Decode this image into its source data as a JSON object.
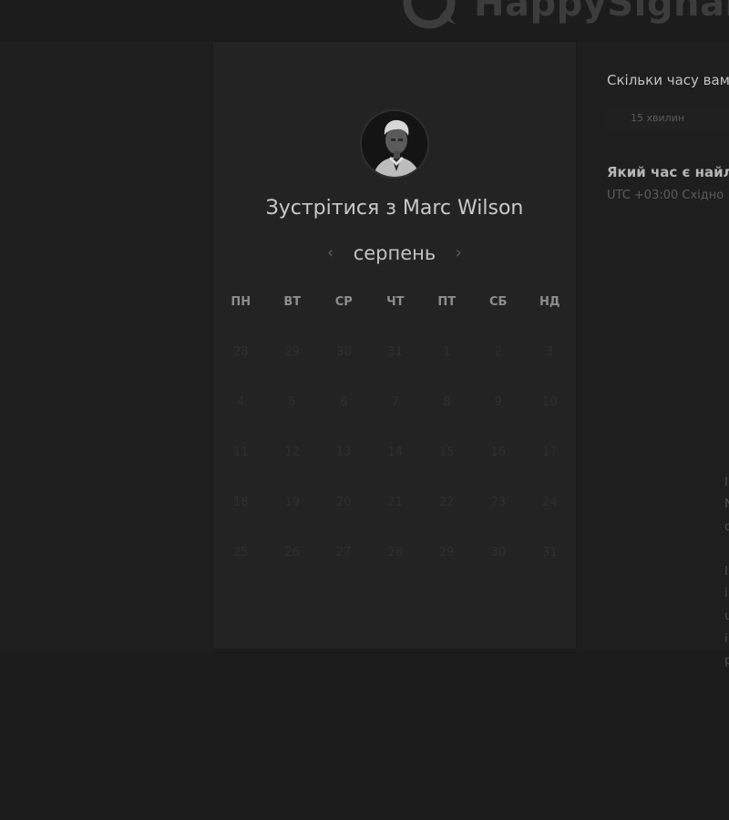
{
  "brand": {
    "logo_text": "HappySignals",
    "logo_icon": "speech-bubble-heart-icon"
  },
  "booking": {
    "title": "Зустрітися з Marc Wilson",
    "month": "серпень",
    "prev_icon": "chevron-left-icon",
    "next_icon": "chevron-right-icon",
    "weekdays": [
      "ПН",
      "ВТ",
      "СР",
      "ЧТ",
      "ПТ",
      "СБ",
      "НД"
    ],
    "days": [
      [
        "28",
        "29",
        "30",
        "31",
        "1",
        "2",
        "3"
      ],
      [
        "4",
        "5",
        "6",
        "7",
        "8",
        "9",
        "10"
      ],
      [
        "11",
        "12",
        "13",
        "14",
        "15",
        "16",
        "17"
      ],
      [
        "18",
        "19",
        "20",
        "21",
        "22",
        "23",
        "24"
      ],
      [
        "25",
        "26",
        "27",
        "28",
        "29",
        "30",
        "31"
      ]
    ]
  },
  "options": {
    "duration_question": "Скільки часу вам",
    "duration_value": "15 хвилин",
    "time_question": "Який час є найліп",
    "timezone": "UTC +03:00 Східно"
  },
  "right_fragments": [
    "I",
    "N",
    "c",
    "I",
    "i",
    "u",
    "i",
    "p"
  ]
}
